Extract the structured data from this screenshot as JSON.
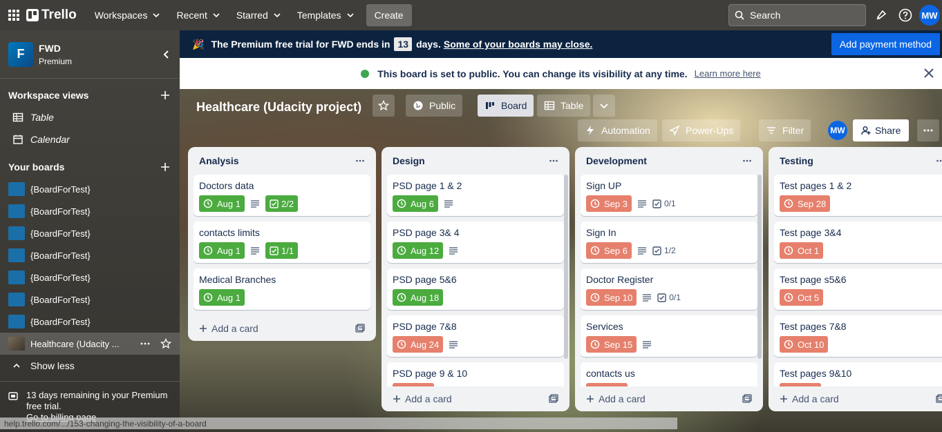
{
  "topnav": {
    "brand": "Trello",
    "menus": [
      "Workspaces",
      "Recent",
      "Starred",
      "Templates"
    ],
    "create": "Create",
    "search_placeholder": "Search",
    "avatar": "MW"
  },
  "sidebar": {
    "workspace_letter": "F",
    "workspace_name": "FWD",
    "workspace_plan": "Premium",
    "views_title": "Workspace views",
    "views": [
      "Table",
      "Calendar"
    ],
    "boards_title": "Your boards",
    "boards": [
      "{BoardForTest}",
      "{BoardForTest}",
      "{BoardForTest}",
      "{BoardForTest}",
      "{BoardForTest}",
      "{BoardForTest}",
      "{BoardForTest}"
    ],
    "active_board": "Healthcare (Udacity ...",
    "show_less": "Show less",
    "trial_text": "13 days remaining in your Premium free trial.",
    "billing_link": "Go to billing page"
  },
  "promo": {
    "text_before": "The Premium free trial for FWD ends in",
    "days": "13",
    "text_after": "days.",
    "link": "Some of your boards may close.",
    "button": "Add payment method"
  },
  "notice": {
    "text": "This board is set to public. You can change its visibility at any time.",
    "link": "Learn more here"
  },
  "board": {
    "title": "Healthcare (Udacity project)",
    "visibility": "Public",
    "view_board": "Board",
    "view_table": "Table",
    "automation": "Automation",
    "powerups": "Power-Ups",
    "filter": "Filter",
    "member": "MW",
    "share": "Share"
  },
  "lists": [
    {
      "title": "Analysis",
      "add": "Add a card",
      "cards": [
        {
          "title": "Doctors data",
          "date": "Aug 1",
          "color": "g",
          "desc": true,
          "check": "2/2",
          "check_done": true
        },
        {
          "title": "contacts limits",
          "date": "Aug 1",
          "color": "g",
          "desc": true,
          "check": "1/1",
          "check_done": true
        },
        {
          "title": "Medical Branches",
          "date": "Aug 1",
          "color": "g",
          "desc": false,
          "check": "",
          "check_done": false
        }
      ]
    },
    {
      "title": "Design",
      "add": "Add a card",
      "cards": [
        {
          "title": "PSD page 1 & 2",
          "date": "Aug 6",
          "color": "g",
          "desc": true,
          "check": "",
          "check_done": false
        },
        {
          "title": "PSD page 3& 4",
          "date": "Aug 12",
          "color": "g",
          "desc": true,
          "check": "",
          "check_done": false
        },
        {
          "title": "PSD page 5&6",
          "date": "Aug 18",
          "color": "g",
          "desc": false,
          "check": "",
          "check_done": false
        },
        {
          "title": "PSD page 7&8",
          "date": "Aug 24",
          "color": "r",
          "desc": true,
          "check": "",
          "check_done": false
        },
        {
          "title": "PSD page 9 & 10",
          "date": "",
          "color": "r",
          "desc": false,
          "check": "",
          "check_done": false
        }
      ]
    },
    {
      "title": "Development",
      "add": "Add a card",
      "cards": [
        {
          "title": "Sign UP",
          "date": "Sep 3",
          "color": "r",
          "desc": true,
          "check": "0/1",
          "check_done": false
        },
        {
          "title": "Sign In",
          "date": "Sep 6",
          "color": "r",
          "desc": true,
          "check": "1/2",
          "check_done": false
        },
        {
          "title": "Doctor Register",
          "date": "Sep 10",
          "color": "r",
          "desc": true,
          "check": "0/1",
          "check_done": false
        },
        {
          "title": "Services",
          "date": "Sep 15",
          "color": "r",
          "desc": true,
          "check": "",
          "check_done": false
        },
        {
          "title": "contacts us",
          "date": "",
          "color": "r",
          "desc": false,
          "check": "",
          "check_done": false
        }
      ]
    },
    {
      "title": "Testing",
      "add": "Add a card",
      "cards": [
        {
          "title": "Test pages 1 & 2",
          "date": "Sep 28",
          "color": "r",
          "desc": false,
          "check": "",
          "check_done": false
        },
        {
          "title": "Test page 3&4",
          "date": "Oct 1",
          "color": "r",
          "desc": false,
          "check": "",
          "check_done": false
        },
        {
          "title": "Test page s5&6",
          "date": "Oct 5",
          "color": "r",
          "desc": false,
          "check": "",
          "check_done": false
        },
        {
          "title": "Test pages 7&8",
          "date": "Oct 10",
          "color": "r",
          "desc": false,
          "check": "",
          "check_done": false
        },
        {
          "title": "Test pages 9&10",
          "date": "",
          "color": "r",
          "desc": false,
          "check": "",
          "check_done": false
        }
      ]
    }
  ],
  "statusbar": "help.trello.com/.../153-changing-the-visibility-of-a-board"
}
